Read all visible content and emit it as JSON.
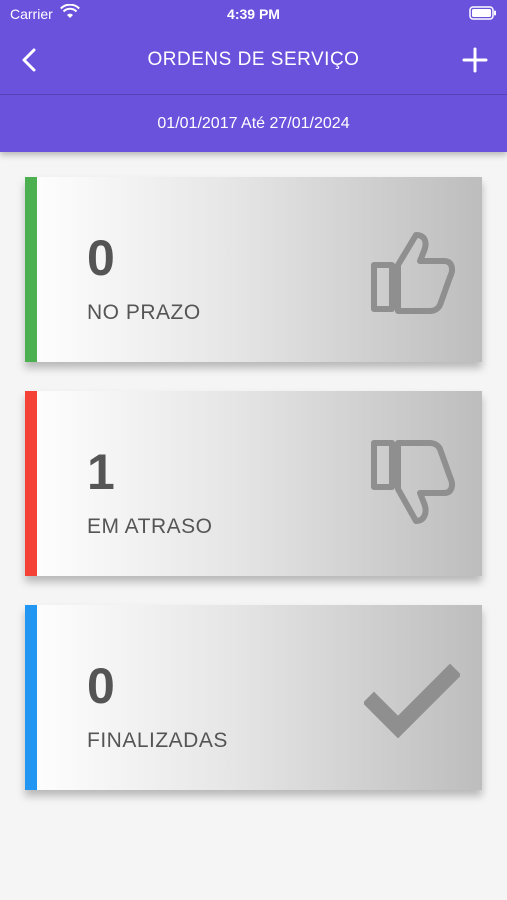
{
  "status_bar": {
    "carrier": "Carrier",
    "time": "4:39 PM"
  },
  "header": {
    "title": "ORDENS DE SERVIÇO",
    "date_range": "01/01/2017 Até 27/01/2024"
  },
  "cards": [
    {
      "count": "0",
      "label": "NO PRAZO",
      "accent": "#4caf50",
      "icon": "thumbs-up-icon"
    },
    {
      "count": "1",
      "label": "EM ATRASO",
      "accent": "#f44336",
      "icon": "thumbs-down-icon"
    },
    {
      "count": "0",
      "label": "FINALIZADAS",
      "accent": "#2196f3",
      "icon": "checkmark-icon"
    }
  ],
  "colors": {
    "header_bg": "#6a52dd",
    "icon_gray": "#8f8f8f"
  }
}
